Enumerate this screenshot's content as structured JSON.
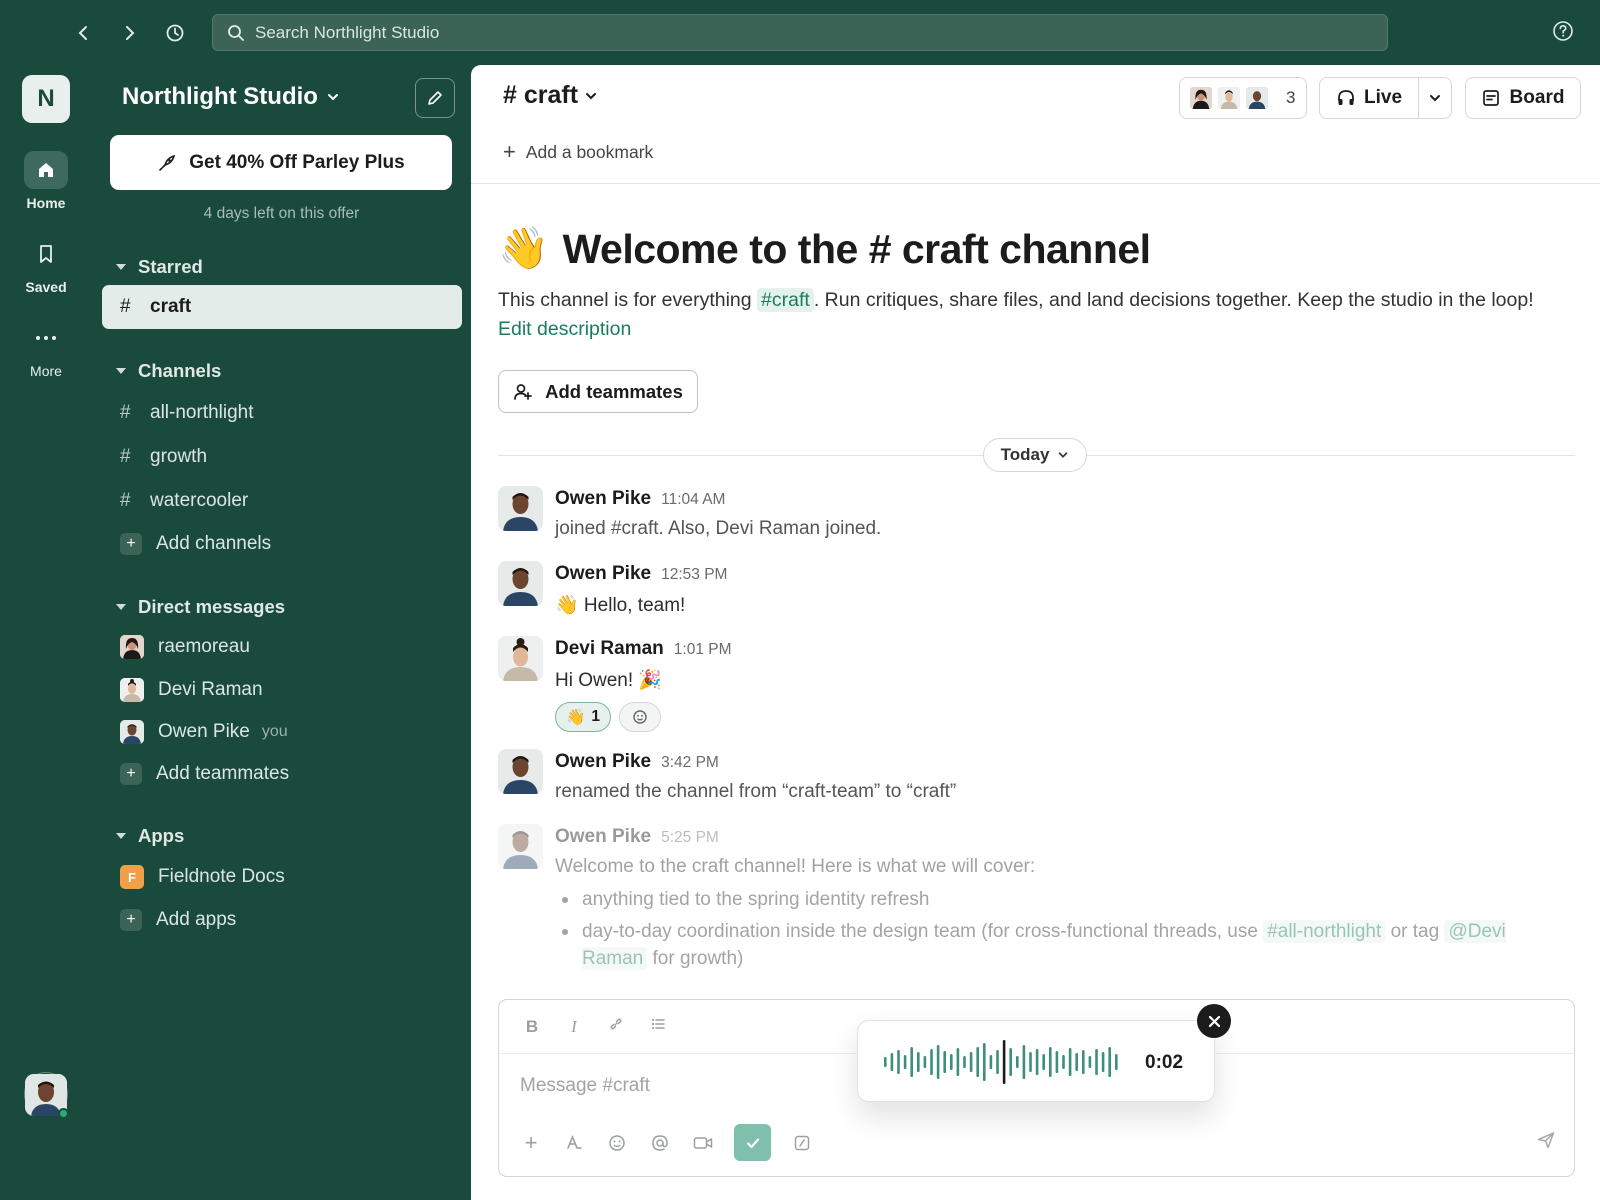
{
  "topbar": {
    "search_placeholder": "Search Northlight Studio",
    "icons": [
      "back-icon",
      "forward-icon",
      "history-icon",
      "search-icon",
      "help-icon"
    ]
  },
  "rail": {
    "workspace_initial": "N",
    "home_label": "Home",
    "saved_label": "Saved",
    "more_label": "More"
  },
  "sidebar": {
    "workspace_name": "Northlight Studio",
    "promo_label": "Get 40% Off Parley Plus",
    "promo_sub": "4 days left on this offer",
    "starred_title": "Starred",
    "starred": [
      {
        "label": "craft"
      }
    ],
    "channels_title": "Channels",
    "channels": [
      {
        "label": "all-northlight"
      },
      {
        "label": "growth"
      },
      {
        "label": "watercooler"
      }
    ],
    "add_channels": "Add channels",
    "dms_title": "Direct messages",
    "dms": [
      {
        "label": "raemoreau"
      },
      {
        "label": "Devi Raman"
      },
      {
        "label": "Owen Pike",
        "tag": "you"
      }
    ],
    "add_teammates": "Add teammates",
    "apps_title": "Apps",
    "apps": [
      {
        "label": "Fieldnote Docs",
        "initial": "F"
      }
    ],
    "add_apps": "Add apps"
  },
  "header": {
    "channel": "# craft",
    "member_count": "3",
    "live_label": "Live",
    "board_label": "Board",
    "bookmark_label": "Add a bookmark"
  },
  "intro": {
    "emoji": "👋",
    "title": "Welcome to the # craft channel",
    "desc_before": "This channel is for everything",
    "desc_tag": "#craft",
    "desc_after": ". Run critiques, share files, and land decisions together. Keep the studio in the loop!",
    "edit_label": "Edit description",
    "add_teammates_label": "Add teammates"
  },
  "day_label": "Today",
  "messages": [
    {
      "author": "Owen Pike",
      "time": "11:04 AM",
      "text": "joined #craft. Also, Devi Raman joined."
    },
    {
      "author": "Owen Pike",
      "time": "12:53 PM",
      "text": "👋 Hello, team!"
    },
    {
      "author": "Devi Raman",
      "time": "1:01 PM",
      "text": "Hi Owen! 🎉",
      "reaction_emoji": "👋",
      "reaction_count": "1"
    },
    {
      "author": "Owen Pike",
      "time": "3:42 PM",
      "text": "renamed the channel from “craft-team” to “craft”"
    },
    {
      "author": "Owen Pike",
      "time": "5:25 PM",
      "text": "Welcome to the craft channel! Here is what we will cover:",
      "bullet1": "anything tied to the spring identity refresh",
      "bullet2_before": "day-to-day coordination inside the design team (for cross-functional threads, use",
      "bullet2_tag": "#all-northlight",
      "bullet2_mid": "or tag",
      "bullet2_mention": "@Devi Raman",
      "bullet2_after": "for growth)"
    }
  ],
  "composer": {
    "placeholder": "Message #craft",
    "format_bold": "B",
    "format_italic": "I",
    "voice_duration": "0:02"
  },
  "colors": {
    "brand": "#1a4a3c",
    "accent": "#1a7c5e",
    "surface": "#ffffff"
  }
}
